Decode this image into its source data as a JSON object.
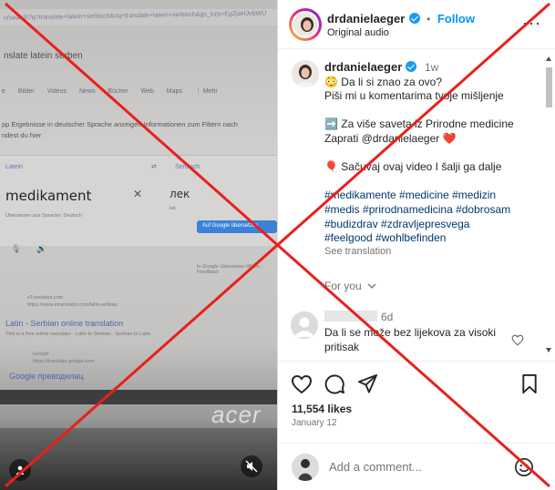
{
  "video": {
    "url_text": "n/search?q=translate+latein+serbisch&oq=translate+latein+serbisch&gs_lcrp=EgZjaHJvbWU",
    "query_text": "nslate latein serben",
    "tabs": [
      "e",
      "Bilder",
      "Videos",
      "News",
      "Bücher",
      "Web",
      "Maps",
      "⋮ Mehr"
    ],
    "lang_notice": "pp  Ergebnisse in deutscher Sprache anzeigen   Informationen zum Filtern nach",
    "lang_notice2": "ndest du hier",
    "source_lang": "Latein",
    "target_lang": "Serbisch",
    "swap_icon": "swap-arrows-icon",
    "source_text": "medikament",
    "target_text": "лек",
    "source_hint": "Übersetzen aus Sprache: Deutsch",
    "target_hint": "lek",
    "open_in_google": "Auf Google übersetzen",
    "feedback": "In Google Übersetzer öffnen · Feedback",
    "result1_site": "eTranslator.com",
    "result1_url": "https://www.etranslator.com/latin-serbian",
    "result1_title": "Latin - Serbian online translation",
    "result1_desc": "This is a free online translator · Latin to Serbian · Serbian to Latin",
    "result2_site": "Google",
    "result2_url": "https://translate.google.com",
    "result2_title": "Google преводилац",
    "brand_logo": "acer"
  },
  "header": {
    "username": "drdanielaeger",
    "follow_label": "Follow",
    "separator": "•",
    "audio_label": "Original audio",
    "more_icon": "more-dots-icon"
  },
  "caption": {
    "username": "drdanielaeger",
    "age": "1w",
    "lines": [
      "😳 Da li si znao za ovo?",
      "Piši mi u komentarima tvoje mišljenje",
      "",
      "➡️ Za više saveta iz Prirodne medicine",
      "Zaprati @drdanielaeger ❤️",
      "",
      "🎈 Sačuvaj ovaj video I šalji ga dalje",
      ""
    ],
    "hashtag_lines": [
      "#medikamente #medicine #medizin",
      "#medis #prirodnamedicina #dobrosam",
      "#budizdrav #zdravljepresvega",
      "#feelgood #wohlbefinden"
    ],
    "see_translation": "See translation"
  },
  "for_you": {
    "label": "For you",
    "icon": "chevron-down-icon"
  },
  "comment": {
    "age": "6d",
    "text_line1": "Da li se može bez lijekova za visoki",
    "text_line2": "pritisak",
    "like_icon": "heart-outline-icon"
  },
  "actions": {
    "like_icon": "heart-outline-icon",
    "comment_icon": "comment-bubble-icon",
    "share_icon": "paper-plane-icon",
    "save_icon": "bookmark-icon"
  },
  "likes": "11,554 likes",
  "date": "January 12",
  "comment_box": {
    "placeholder": "Add a comment...",
    "emoji_icon": "smiley-icon"
  },
  "colors": {
    "accent": "#0095f6",
    "verified": "#1d9bf0",
    "hashtag": "#00376b",
    "overlay_x": "#e8201c"
  }
}
